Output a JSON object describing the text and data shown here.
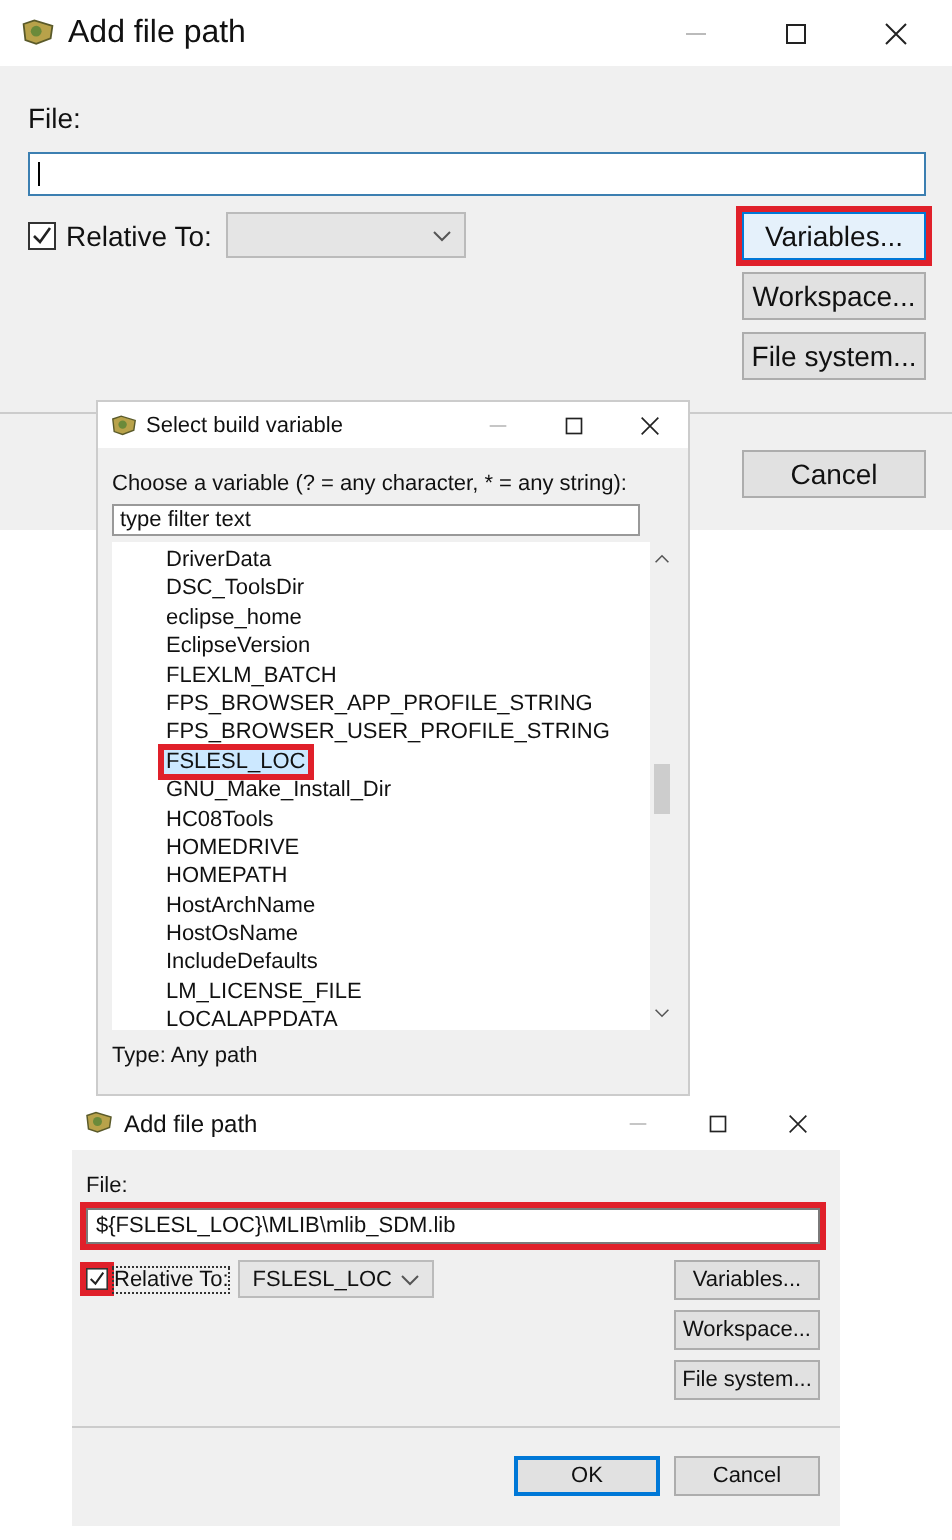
{
  "windows": [
    {
      "kind": "add_file_path",
      "title": "Add file path",
      "file_label": "File:",
      "file_field": {
        "focused": true,
        "highlighted": false
      },
      "relative": {
        "label": "Relative To:",
        "checked": true,
        "highlighted": false,
        "focused": false
      },
      "buttons": [
        {
          "label": "Variables...",
          "highlighted": true
        },
        {
          "label": "Workspace...",
          "highlighted": false
        },
        {
          "label": "File system...",
          "highlighted": false
        }
      ],
      "footer_buttons": [
        {
          "label": "Cancel",
          "default": false
        }
      ]
    },
    {
      "kind": "select_variable",
      "title": "Select build variable",
      "prompt": "Choose a variable (? = any character, * = any string):",
      "filter": {
        "placeholder": "type filter text"
      },
      "items": [
        {
          "label": "DriverData",
          "selected": false,
          "highlighted": false
        },
        {
          "label": "DSC_ToolsDir",
          "selected": false,
          "highlighted": false
        },
        {
          "label": "eclipse_home",
          "selected": false,
          "highlighted": false
        },
        {
          "label": "EclipseVersion",
          "selected": false,
          "highlighted": false
        },
        {
          "label": "FLEXLM_BATCH",
          "selected": false,
          "highlighted": false
        },
        {
          "label": "FPS_BROWSER_APP_PROFILE_STRING",
          "selected": false,
          "highlighted": false
        },
        {
          "label": "FPS_BROWSER_USER_PROFILE_STRING",
          "selected": false,
          "highlighted": false
        },
        {
          "label": "FSLESL_LOC",
          "selected": true,
          "highlighted": true
        },
        {
          "label": "GNU_Make_Install_Dir",
          "selected": false,
          "highlighted": false
        },
        {
          "label": "HC08Tools",
          "selected": false,
          "highlighted": false
        },
        {
          "label": "HOMEDRIVE",
          "selected": false,
          "highlighted": false
        },
        {
          "label": "HOMEPATH",
          "selected": false,
          "highlighted": false
        },
        {
          "label": "HostArchName",
          "selected": false,
          "highlighted": false
        },
        {
          "label": "HostOsName",
          "selected": false,
          "highlighted": false
        },
        {
          "label": "IncludeDefaults",
          "selected": false,
          "highlighted": false
        },
        {
          "label": "LM_LICENSE_FILE",
          "selected": false,
          "highlighted": false
        },
        {
          "label": "LOCALAPPDATA",
          "selected": false,
          "highlighted": false
        }
      ],
      "type_text": "Type: Any path"
    },
    {
      "kind": "add_file_path",
      "title": "Add file path",
      "file_label": "File:",
      "file_field": {
        "value": "${FSLESL_LOC}\\MLIB\\mlib_SDM.lib",
        "focused": false,
        "highlighted": true
      },
      "relative": {
        "label": "Relative To:",
        "checked": true,
        "highlighted": true,
        "focused": true
      },
      "relative_combo": {
        "value": "FSLESL_LOC"
      },
      "buttons": [
        {
          "label": "Variables...",
          "highlighted": false
        },
        {
          "label": "Workspace...",
          "highlighted": false
        },
        {
          "label": "File system...",
          "highlighted": false
        }
      ],
      "footer_buttons": [
        {
          "label": "OK",
          "default": true
        },
        {
          "label": "Cancel",
          "default": false
        }
      ]
    }
  ]
}
